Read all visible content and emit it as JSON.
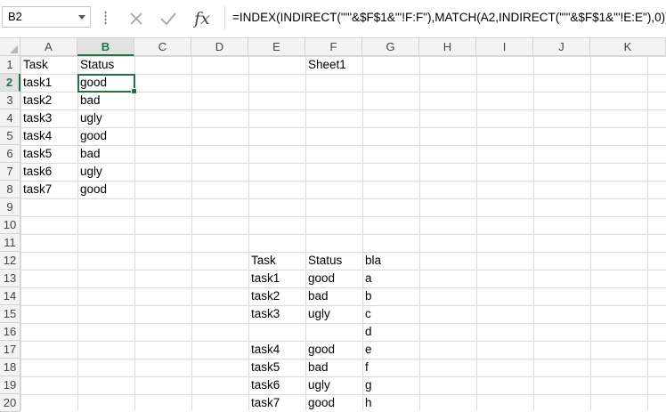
{
  "name_box": {
    "value": "B2"
  },
  "formula_bar": {
    "cancel_icon": "cross-icon",
    "enter_icon": "check-icon",
    "function_label": "fx",
    "formula": "=INDEX(INDIRECT(\"'\"&$F$1&\"'!F:F\"),MATCH(A2,INDIRECT(\"'\"&$F$1&\"'!E:E\"),0))"
  },
  "columns": [
    "A",
    "B",
    "C",
    "D",
    "E",
    "F",
    "G",
    "H",
    "I",
    "J",
    "K"
  ],
  "rows": [
    "1",
    "2",
    "3",
    "4",
    "5",
    "6",
    "7",
    "8",
    "9",
    "10",
    "11",
    "12",
    "13",
    "14",
    "15",
    "16",
    "17",
    "18",
    "19",
    "20"
  ],
  "selected": {
    "column": "B",
    "row": "2"
  },
  "cells": {
    "A1": "Task",
    "B1": "Status",
    "F1": "Sheet1",
    "A2": "task1",
    "B2": "good",
    "A3": "task2",
    "B3": "bad",
    "A4": "task3",
    "B4": "ugly",
    "A5": "task4",
    "B5": "good",
    "A6": "task5",
    "B6": "bad",
    "A7": "task6",
    "B7": "ugly",
    "A8": "task7",
    "B8": "good",
    "E12": "Task",
    "F12": "Status",
    "G12": "bla",
    "E13": "task1",
    "F13": "good",
    "G13": "a",
    "E14": "task2",
    "F14": "bad",
    "G14": "b",
    "E15": "task3",
    "F15": "ugly",
    "G15": "c",
    "G16": "d",
    "E17": "task4",
    "F17": "good",
    "G17": "e",
    "E18": "task5",
    "F18": "bad",
    "G18": "f",
    "E19": "task6",
    "F19": "ugly",
    "G19": "g",
    "E20": "task7",
    "F20": "good",
    "G20": "h"
  },
  "colors": {
    "accent": "#217346",
    "gridline": "#dadada",
    "header_bg": "#f3f3f3"
  }
}
